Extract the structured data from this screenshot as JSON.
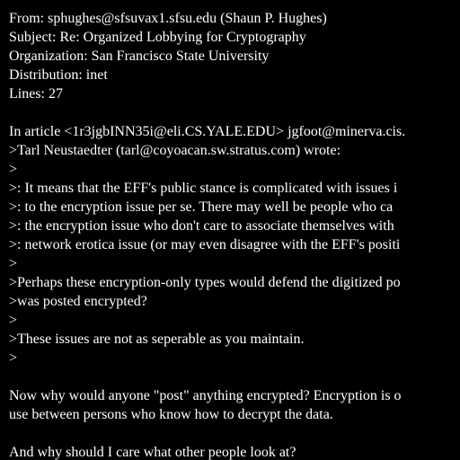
{
  "colors": {
    "background": "#000000",
    "text": "#ffffff"
  },
  "header": {
    "from": "From: sphughes@sfsuvax1.sfsu.edu (Shaun P. Hughes)",
    "subject": "Subject: Re: Organized Lobbying for Cryptography",
    "organization": "Organization: San Francisco State University",
    "distribution": "Distribution: inet",
    "lines": "Lines: 27"
  },
  "body": {
    "lines": [
      "In article <1r3jgbINN35i@eli.CS.YALE.EDU> jgfoot@minerva.cis.",
      ">Tarl Neustaedter (tarl@coyoacan.sw.stratus.com) wrote:",
      ">",
      ">: It means that the EFF's public stance is complicated with issues i",
      ">: to the encryption issue per se. There may well be people who ca",
      ">: the encryption issue who don't care to associate themselves with",
      ">: network erotica issue (or may even disagree with the EFF's positi",
      ">",
      ">Perhaps these encryption-only types would defend the digitized po",
      ">was posted encrypted?",
      ">",
      ">These issues are not as seperable as you maintain.",
      ">",
      "",
      "Now why would anyone \"post\" anything encrypted? Encryption is o",
      "use between persons who know how to decrypt the data.",
      "",
      "And why should I care what other people look at?"
    ]
  }
}
